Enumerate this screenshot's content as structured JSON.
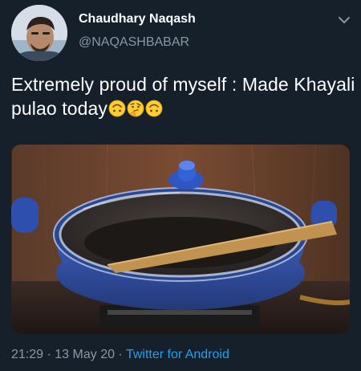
{
  "user": {
    "display_name": "Chaudhary Naqash",
    "handle": "@NAQASHBABAR"
  },
  "tweet": {
    "text": "Extremely proud of myself : Made Khayali pulao today",
    "emojis": [
      "upside-down-face",
      "thinking-face",
      "upside-down-face"
    ]
  },
  "meta": {
    "time": "21:29",
    "date": "13 May 20",
    "separator": "·",
    "source": "Twitter for Android"
  },
  "colors": {
    "background": "#15202b",
    "secondary_text": "#8899a6",
    "link": "#1da1f2",
    "pan_blue": "#2e4a9e"
  }
}
